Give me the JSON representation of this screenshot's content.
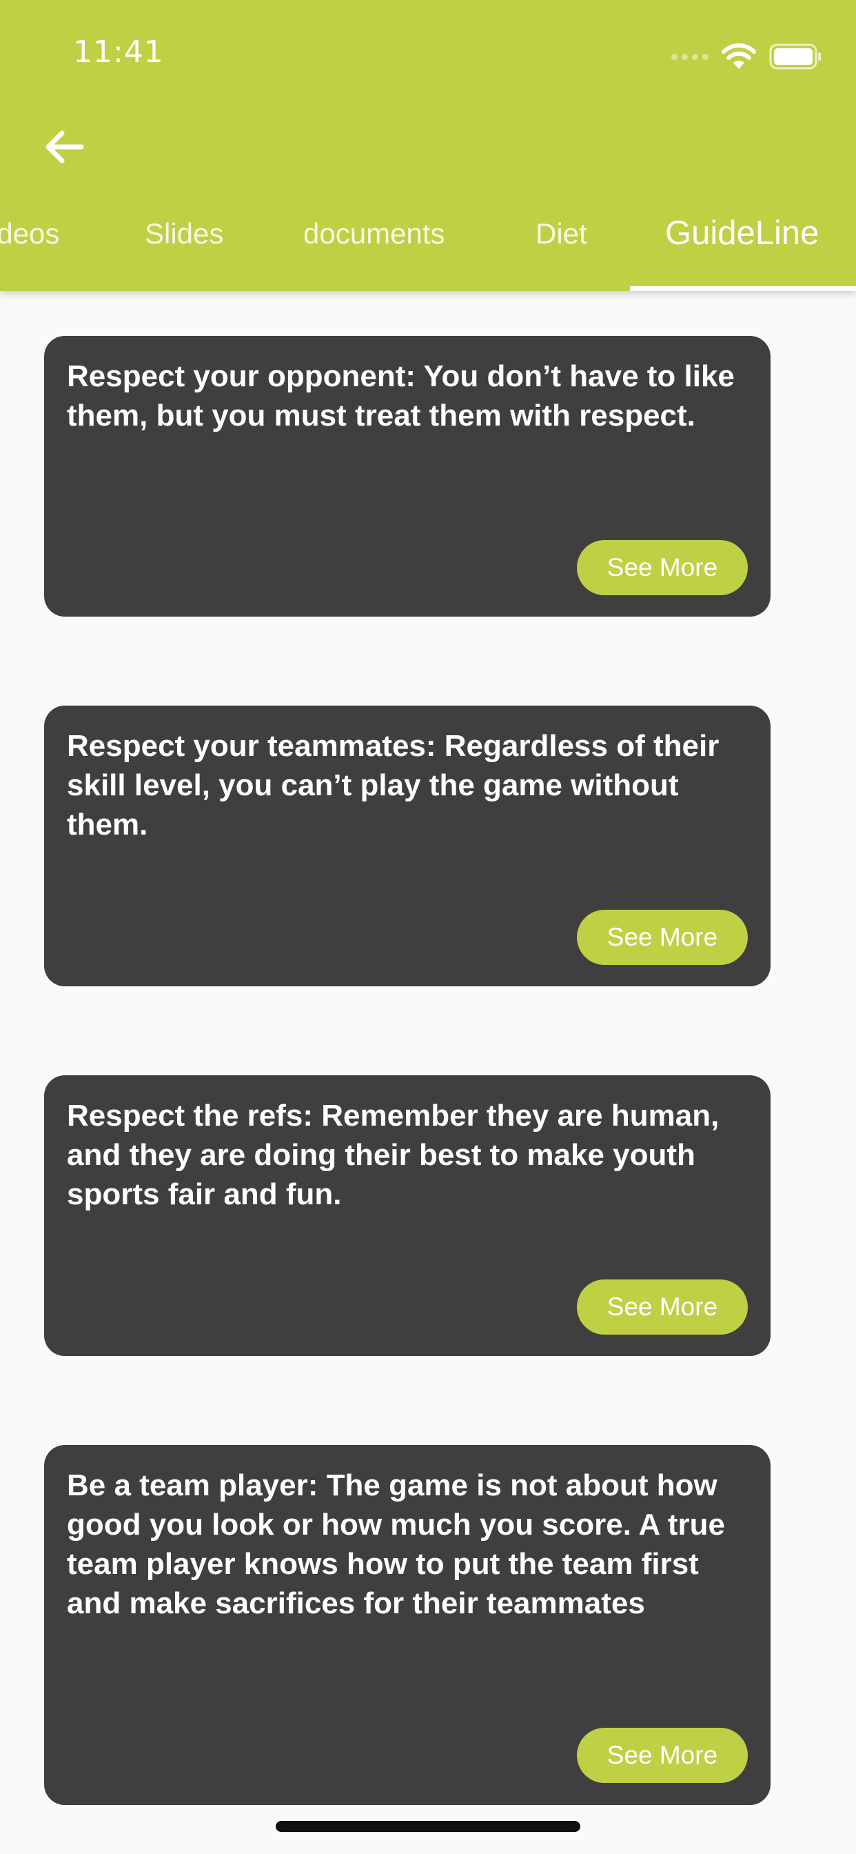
{
  "status_bar": {
    "time": "11:41",
    "icons": [
      "signal-icon",
      "wifi-icon",
      "battery-icon"
    ]
  },
  "app_bar": {
    "back_icon": "back-arrow-icon",
    "tabs": [
      {
        "label": "ideos",
        "active": false
      },
      {
        "label": "Slides",
        "active": false
      },
      {
        "label": "documents",
        "active": false
      },
      {
        "label": "Diet",
        "active": false
      },
      {
        "label": "GuideLine",
        "active": true
      }
    ]
  },
  "guidelines": [
    {
      "text": "Respect your opponent: You don’t have to like them, but you must treat them with respect.",
      "button": "See More"
    },
    {
      "text": "Respect your teammates: Regardless of their skill level, you can’t play the game without them.",
      "button": "See More"
    },
    {
      "text": "Respect the refs: Remember they are human, and they are doing their best to make youth sports fair and fun.",
      "button": "See More"
    },
    {
      "text": "Be a team player: The game is not about how good you look or how much you score. A true team player knows how to put the team first and make sacrifices for their teammates",
      "button": "See More"
    }
  ],
  "colors": {
    "accent": "#bfd045",
    "card": "#3f3f3f",
    "background": "#fafafa",
    "text_on_dark": "#ffffff"
  }
}
